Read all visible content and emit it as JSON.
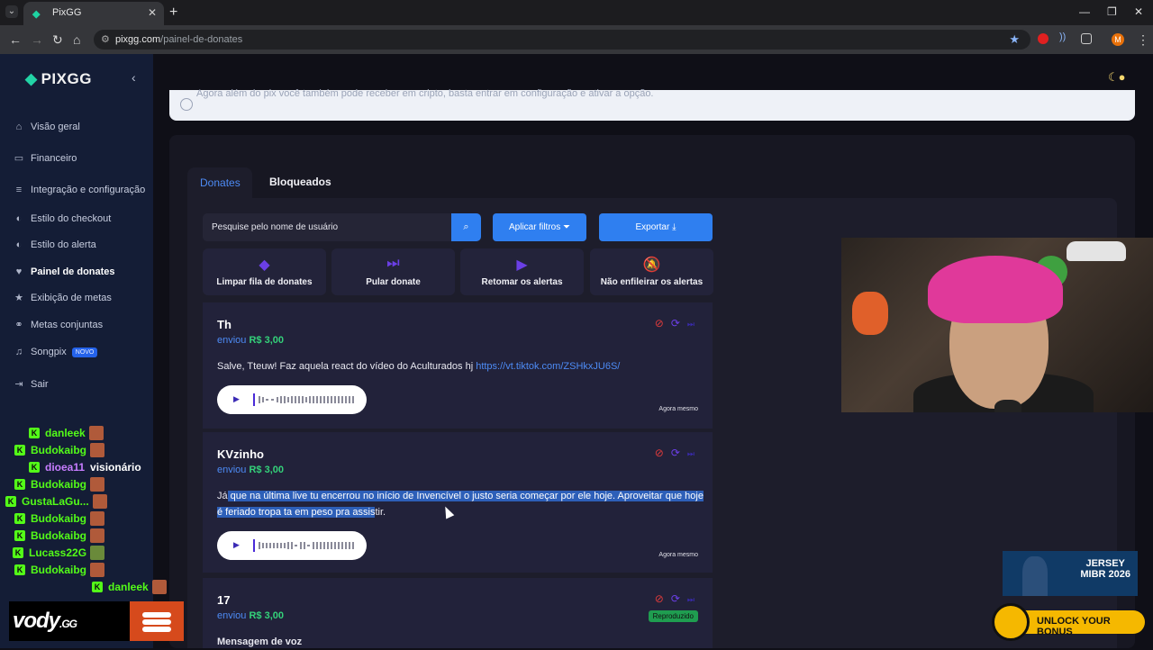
{
  "browser": {
    "tab_title": "PixGG",
    "url_host": "pixgg.com",
    "url_path": "/painel-de-donates"
  },
  "sidebar": {
    "logo": "PIXGG",
    "items": [
      {
        "label": "Visão geral",
        "icon": "home-icon"
      },
      {
        "label": "Financeiro",
        "icon": "wallet-icon"
      },
      {
        "label": "Integração e configuração",
        "icon": "settings-icon"
      },
      {
        "label": "Estilo do checkout",
        "icon": "palette-icon"
      },
      {
        "label": "Estilo do alerta",
        "icon": "palette-icon"
      },
      {
        "label": "Painel de donates",
        "icon": "donate-icon"
      },
      {
        "label": "Exibição de metas",
        "icon": "star-icon"
      },
      {
        "label": "Metas conjuntas",
        "icon": "handshake-icon"
      },
      {
        "label": "Songpix",
        "icon": "music-icon",
        "badge": "NOVO"
      },
      {
        "label": "Sair",
        "icon": "logout-icon"
      }
    ]
  },
  "banner": {
    "text": "Agora além do pix você também pode receber em cripto, basta entrar em configuração e ativar a opção."
  },
  "tabs": {
    "donates": "Donates",
    "bloqueados": "Bloqueados"
  },
  "toolbar": {
    "search_placeholder": "Pesquise pelo nome de usuário",
    "filter_label": "Aplicar filtros",
    "export_label": "Exportar"
  },
  "actions": [
    {
      "label": "Limpar fila de donates",
      "icon": "eraser-icon"
    },
    {
      "label": "Pular donate",
      "icon": "skip-icon"
    },
    {
      "label": "Retomar os alertas",
      "icon": "play-icon"
    },
    {
      "label": "Não enfileirar os alertas",
      "icon": "bell-off-icon"
    }
  ],
  "donations": [
    {
      "name": "Th",
      "sent": "enviou",
      "amount": "R$ 3,00",
      "message": "Salve, Tteuw! Faz aquela react do vídeo do Aculturados hj ",
      "link": "https://vt.tiktok.com/ZSHkxJU6S/",
      "time": "Agora mesmo"
    },
    {
      "name": "KVzinho",
      "sent": "enviou",
      "amount": "R$ 3,00",
      "message_pre": "Já",
      "message_hl": " que na última live tu encerrou no início de Invencível o justo seria começar por ele hoje. Aproveitar que hoje é feriado tropa ta em peso pra assis",
      "message_post": "tir.",
      "time": "Agora mesmo"
    },
    {
      "name": "17",
      "sent": "enviou",
      "amount": "R$ 3,00",
      "message": "Mensagem de voz",
      "status": "Reproduzido"
    }
  ],
  "chat": [
    {
      "user": "danleek",
      "color": "#53fc18"
    },
    {
      "user": "Budokaibg",
      "color": "#53fc18"
    },
    {
      "user": "dioea11",
      "text": "visionário",
      "color": "#c77dff"
    },
    {
      "user": "Budokaibg",
      "color": "#53fc18"
    },
    {
      "user": "GustaLaGu...",
      "color": "#53fc18"
    },
    {
      "user": "Budokaibg",
      "color": "#53fc18"
    },
    {
      "user": "Budokaibg",
      "color": "#53fc18"
    },
    {
      "user": "Lucass22G",
      "color": "#53fc18"
    },
    {
      "user": "Budokaibg",
      "color": "#53fc18"
    },
    {
      "user": "danleek",
      "color": "#53fc18"
    }
  ],
  "overlays": {
    "vody": "vody",
    "vody_suffix": ".GG",
    "mibr_line1": "JERSEY",
    "mibr_line2": "MIBR 2026",
    "unlock": "UNLOCK YOUR BONUS"
  },
  "colors": {
    "accent_blue": "#2f7ff0",
    "amount_green": "#34d27a",
    "kick_green": "#53fc18",
    "sidebar_bg": "#141d36"
  }
}
